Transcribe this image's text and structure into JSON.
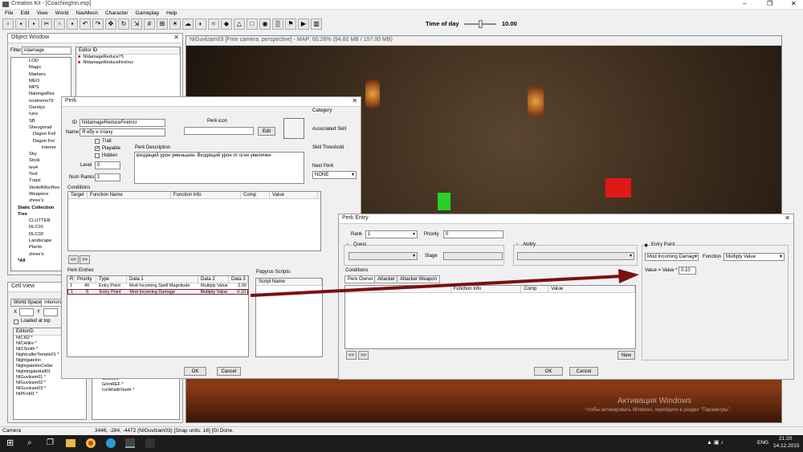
{
  "app": {
    "title": "Creation Kit - [CoachingInn.esp]"
  },
  "menu": [
    "File",
    "Edit",
    "View",
    "World",
    "NavMesh",
    "Character",
    "Gameplay",
    "Help"
  ],
  "toolbar": {
    "time_label": "Time of day",
    "time_value": "10.00"
  },
  "object_window": {
    "title": "Object Window",
    "filter_label": "Filter",
    "filter_value": "ndamage",
    "tree": [
      "LOD",
      "Magic",
      "Markers",
      "MEO",
      "MPS",
      "NalongaRes",
      "nostromo79",
      "Oarstys",
      "runs",
      "SB",
      "Sheogorad",
      "Dagon Fell",
      "Dagon Fel",
      "interior",
      "Sky",
      "Strok",
      "tes4",
      "Text",
      "Traps",
      "VanlotMiscRes",
      "Weapons",
      "zhree's",
      "Static Collection",
      "Tree",
      "CLUTTER",
      "DLC01",
      "DLC02",
      "Landscape",
      "Plants",
      "zhree's",
      "*All"
    ],
    "list_header": "Editor ID",
    "list_items": [
      "NIdamageReduce75",
      "NIdamageReduceFireIncr"
    ]
  },
  "perk": {
    "title": "Perk",
    "id_label": "ID",
    "id_value": "NIdamageReduceFireIncr",
    "name_label": "Name",
    "name_value": "Я ебу и плачу",
    "perk_icon_label": "Perk icon",
    "edit_label": "Edit",
    "trait_label": "Trait",
    "playable_label": "Playable",
    "hidden_label": "Hidden",
    "level_label": "Level",
    "level_value": "0",
    "num_ranks_label": "Num Ranks",
    "num_ranks_value": "1",
    "description_label": "Perk Description",
    "description_value": "входящий урон уменьшен. Входящий урон от огня увеличен",
    "category_label": "Category",
    "skill_label": "Associated Skill",
    "threshold_label": "Skill Threshold",
    "next_perk_label": "Next Perk",
    "next_perk_value": "NONE",
    "conditions_label": "Conditions",
    "conditions_cols": [
      "Target",
      "Function Name",
      "Function Info",
      "Comp",
      "Value"
    ],
    "prev_btn": "<<",
    "next_btn": ">>",
    "entries_label": "Perk Entries",
    "entries_cols": [
      "R",
      "Priority",
      "Type",
      "Data 1",
      "Data 2",
      "Data 3"
    ],
    "entries": [
      [
        "1",
        "40",
        "Entry Point",
        "Mod Incoming Spell Magnitude",
        "Multiply Value",
        "2.00"
      ],
      [
        "1",
        "0",
        "Entry Point",
        "Mod Incoming Damage",
        "Multiply Value",
        "0.10"
      ]
    ],
    "scripts_label": "Papyrus Scripts:",
    "script_name_col": "Script Name",
    "ok_label": "OK",
    "cancel_label": "Cancel"
  },
  "viewport": {
    "title": "NIGuvlzam03 [Free camera, perspective] - MAP: 60.26% (94.60 MB / 157.00 MB)"
  },
  "perk_entry": {
    "title": "Perk Entry",
    "rank_label": "Rank",
    "rank_value": "1",
    "priority_label": "Priority",
    "priority_value": "0",
    "quest_label": "Quest",
    "stage_label": "Stage",
    "ability_label": "Ability",
    "entry_point_label": "Entry Point",
    "entry_point_value": "Mod Incoming Damag",
    "function_label": "Function",
    "function_value": "Multiply Value",
    "value_label": "Value = Value *",
    "value_value": "0.10",
    "conditions_label": "Conditions",
    "tabs": [
      "Perk Owner",
      "Attacker",
      "Attacker Weapon"
    ],
    "cond_cols": [
      "Function Info",
      "Comp",
      "Value"
    ],
    "prev_btn": "<<",
    "next_btn": ">>",
    "new_label": "New",
    "ok_label": "OK",
    "cancel_label": "Cancel"
  },
  "cell_view": {
    "title": "Cell View",
    "tab_world": "World Space",
    "tab_interiors": "Interiors",
    "x_label": "X",
    "y_label": "Y",
    "loaded_label": "Loaded at top",
    "col_editor_id": "EditorID",
    "rows": [
      "NIСI02 *",
      "NICHillre *",
      "NICSmith *",
      "NightcallerTemple01 *",
      "NightgateInn",
      "NightgateInnCellar",
      "NightingaleHall01",
      "NIGuvlzam01 *",
      "NIGuvlzam02 *",
      "NIGuvlzam03 *",
      "NIPFnt01 *"
    ],
    "objects": [
      "Gold001 *",
      "GrimREF *",
      "IceWraithTeeth *"
    ]
  },
  "status": {
    "left": "Camera",
    "coords": "3446, -284, -4472 (NIGuvlzam03) [Snap units: 16] [Gl Done."
  },
  "watermark": {
    "line1": "Активация Windows",
    "line2": "Чтобы активировать Windows, перейдите в раздел \"Параметры\"."
  },
  "taskbar": {
    "time": "21:20",
    "date": "14.12.2015",
    "lang": "ENG"
  }
}
